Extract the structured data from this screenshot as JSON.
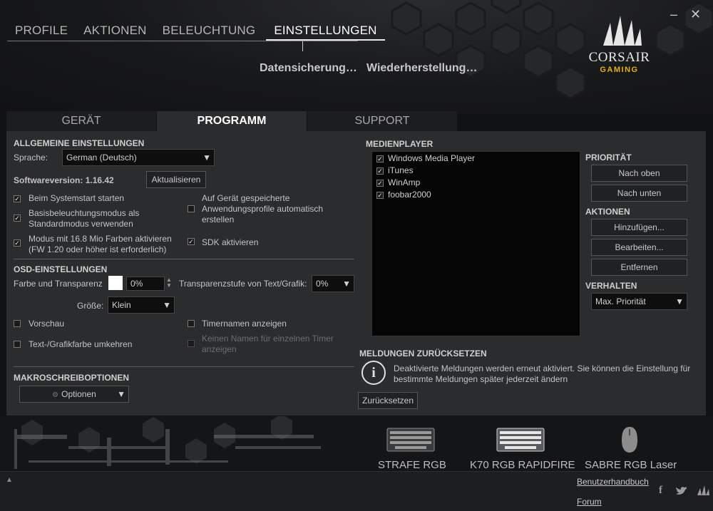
{
  "window": {
    "minimize_icon": "minimize-icon",
    "close_icon": "close-icon"
  },
  "topnav": {
    "tabs": [
      "PROFILE",
      "AKTIONEN",
      "BELEUCHTUNG",
      "EINSTELLUNGEN"
    ],
    "active": "EINSTELLUNGEN"
  },
  "subnav": {
    "backup": "Datensicherung…",
    "restore": "Wiederherstellung…"
  },
  "logo": {
    "brand": "CORSAIR",
    "tagline": "GAMING",
    "accent": "#e8b000"
  },
  "panel_tabs": [
    "GERÄT",
    "PROGRAMM",
    "SUPPORT"
  ],
  "general": {
    "heading": "ALLGEMEINE EINSTELLUNGEN",
    "language_label": "Sprache:",
    "language_value": "German (Deutsch)",
    "version": "Softwareversion: 1.16.42",
    "update_button": "Aktualisieren",
    "options": [
      {
        "label": "Beim Systemstart starten",
        "checked": true
      },
      {
        "label": "Basisbeleuchtungsmodus als Standardmodus verwenden",
        "checked": true
      },
      {
        "label": "Modus mit 16.8 Mio Farben aktivieren (FW 1.20 oder höher ist erforderlich)",
        "checked": true
      },
      {
        "label": "Auf Gerät gespeicherte Anwendungsprofile automatisch erstellen",
        "checked": false
      },
      {
        "label": "SDK aktivieren",
        "checked": true
      }
    ]
  },
  "osd": {
    "heading": "OSD-EINSTELLUNGEN",
    "color_label": "Farbe und Transparenz",
    "color_swatch": "#ffffff",
    "transparency_value": "0%",
    "text_transparency_label": "Transparenzstufe von Text/Grafik:",
    "text_transparency_value": "0%",
    "size_label": "Größe:",
    "size_value": "Klein",
    "preview_label": "Vorschau",
    "invert_label": "Text-/Grafikfarbe umkehren",
    "timer_names_label": "Timernamen anzeigen",
    "no_name_label": "Keinen Namen für einzelnen Timer anzeigen"
  },
  "macro": {
    "heading": "MAKROSCHREIBOPTIONEN",
    "options_button": "Optionen"
  },
  "media": {
    "heading": "MEDIENPLAYER",
    "players": [
      {
        "name": "Windows Media Player",
        "checked": true
      },
      {
        "name": "iTunes",
        "checked": true
      },
      {
        "name": "WinAmp",
        "checked": true
      },
      {
        "name": "foobar2000",
        "checked": true
      }
    ],
    "priority_heading": "PRIORITÄT",
    "up_button": "Nach oben",
    "down_button": "Nach unten",
    "actions_heading": "AKTIONEN",
    "add_button": "Hinzufügen...",
    "edit_button": "Bearbeiten...",
    "remove_button": "Entfernen",
    "behavior_heading": "VERHALTEN",
    "behavior_value": "Max. Priorität"
  },
  "reset": {
    "heading": "MELDUNGEN ZURÜCKSETZEN",
    "text": "Deaktivierte Meldungen werden erneut aktiviert. Sie können die Einstellung für bestimmte Meldungen später jederzeit ändern",
    "button": "Zurücksetzen"
  },
  "devices": [
    {
      "name": "STRAFE RGB"
    },
    {
      "name": "K70 RGB RAPIDFIRE"
    },
    {
      "name": "SABRE RGB Laser"
    }
  ],
  "footer": {
    "manual_link": "Benutzerhandbuch",
    "forum_link": "Forum",
    "social": [
      "facebook-icon",
      "twitter-icon",
      "corsair-icon"
    ]
  }
}
